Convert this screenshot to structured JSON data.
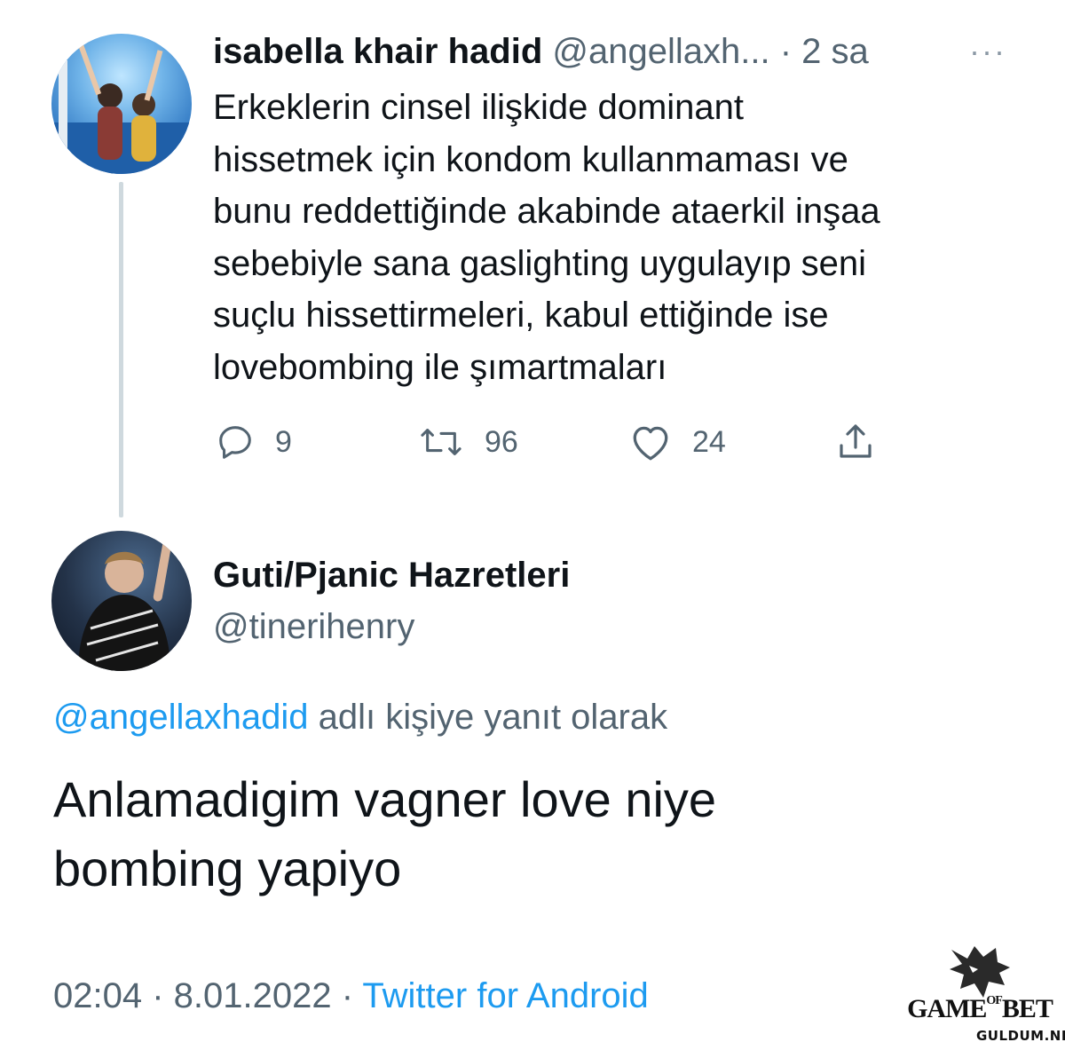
{
  "tweet1": {
    "display_name": "isabella khair hadid",
    "handle": "@angellaxh...",
    "time": "· 2 sa",
    "more": "···",
    "text": "Erkeklerin cinsel ilişkide dominant\nhissetmek için kondom kullanmaması ve\nbunu reddettiğinde akabinde ataerkil inşaa\nsebebiyle sana gaslighting  uygulayıp seni\nsuçlu hissettirmeleri, kabul ettiğinde ise\nlovebombing ile şımartmaları",
    "actions": {
      "reply": {
        "icon": "reply-icon",
        "count": "9"
      },
      "retweet": {
        "icon": "retweet-icon",
        "count": "96"
      },
      "like": {
        "icon": "heart-icon",
        "count": "24"
      },
      "share": {
        "icon": "share-icon"
      }
    }
  },
  "tweet2": {
    "display_name": "Guti/Pjanic Hazretleri",
    "handle": "@tinerihenry",
    "reply_to_mention": "@angellaxhadid",
    "reply_to_suffix": "adlı kişiye yanıt olarak",
    "text": "Anlamadigim vagner love niye\nbombing yapiyo",
    "timestamp": "02:04 · 8.01.2022 ·",
    "source": "Twitter for Android"
  },
  "watermark": {
    "brand_main": "GAME",
    "brand_of": "OF",
    "brand_end": "BET",
    "site": "GULDUM.NET"
  },
  "colors": {
    "link": "#1d9bf0",
    "secondary_text": "#536471",
    "thread_line": "#cfd9de"
  }
}
